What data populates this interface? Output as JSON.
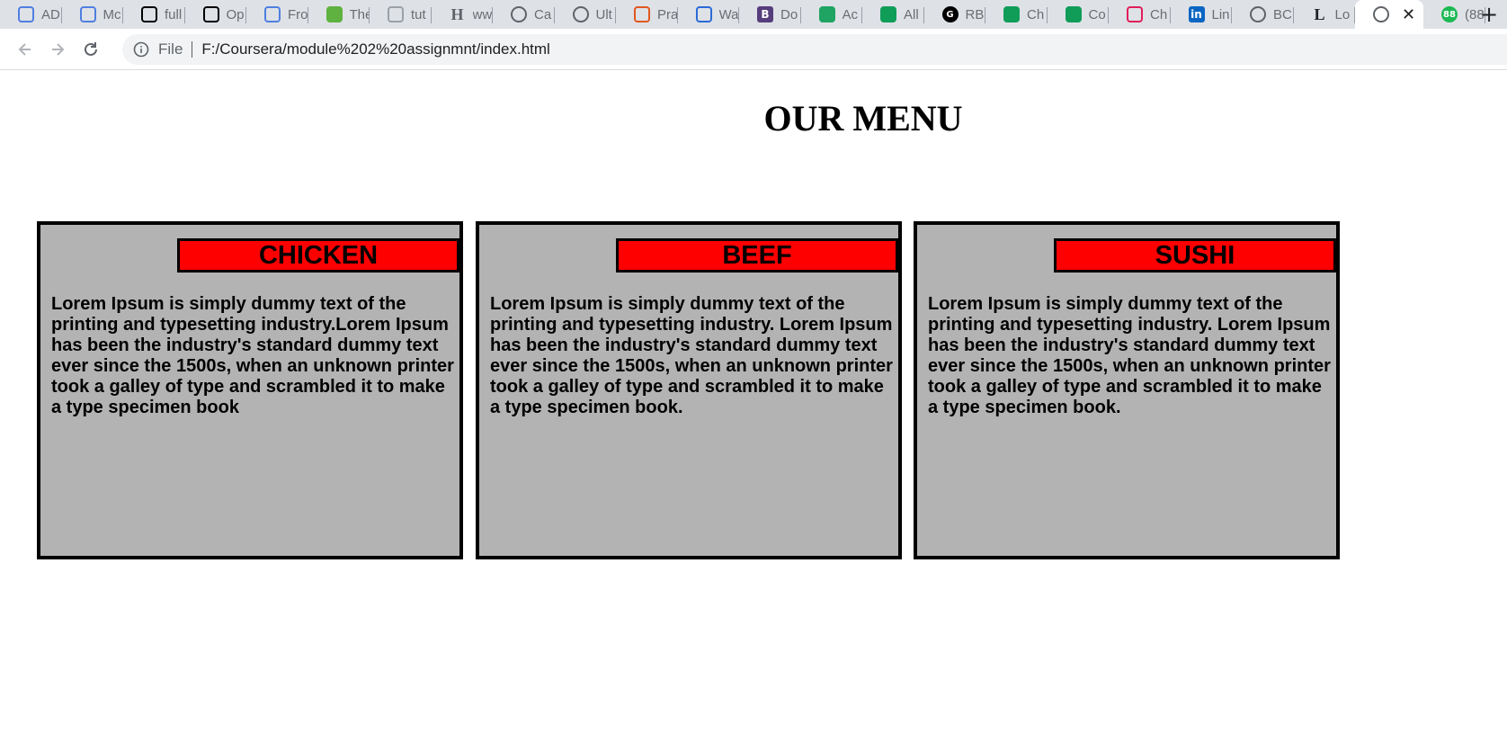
{
  "browser": {
    "tabs": [
      {
        "title": "AD",
        "icon": "infinity-icon",
        "color": "#4f7fe0"
      },
      {
        "title": "Mc",
        "icon": "infinity-icon",
        "color": "#4f7fe0"
      },
      {
        "title": "full",
        "icon": "github-icon",
        "color": "#000000"
      },
      {
        "title": "Op",
        "icon": "github-icon",
        "color": "#000000"
      },
      {
        "title": "Fro",
        "icon": "infinity-icon",
        "color": "#4f7fe0"
      },
      {
        "title": "The",
        "icon": "leaf-icon",
        "color": "#5fb240"
      },
      {
        "title": "tut",
        "icon": "code-icon",
        "color": "#9aa0a6"
      },
      {
        "title": "ww",
        "icon": "h-icon",
        "color": "#5f6368"
      },
      {
        "title": "Ca",
        "icon": "globe-icon",
        "color": "#5f6368"
      },
      {
        "title": "Ult",
        "icon": "globe-icon",
        "color": "#5f6368"
      },
      {
        "title": "Pra",
        "icon": "bracket-icon",
        "color": "#e2571e"
      },
      {
        "title": "Wa",
        "icon": "swirl-icon",
        "color": "#2a6bd8"
      },
      {
        "title": "Do",
        "icon": "bootstrap-icon",
        "color": "#563d7c"
      },
      {
        "title": "Ac",
        "icon": "drive-icon",
        "color": "#1fa463"
      },
      {
        "title": "All",
        "icon": "sheets-icon",
        "color": "#0f9d58"
      },
      {
        "title": "RB",
        "icon": "g-icon",
        "color": "#000000"
      },
      {
        "title": "Ch",
        "icon": "sheets-icon",
        "color": "#0f9d58"
      },
      {
        "title": "Co",
        "icon": "sheets-icon",
        "color": "#0f9d58"
      },
      {
        "title": "Ch",
        "icon": "slack-icon",
        "color": "#e01e5a"
      },
      {
        "title": "Lin",
        "icon": "linkedin-icon",
        "color": "#0a66c2"
      },
      {
        "title": "BC",
        "icon": "globe-icon",
        "color": "#5f6368"
      },
      {
        "title": "Lo",
        "icon": "l-icon",
        "color": "#202124"
      },
      {
        "title": "",
        "icon": "globe-icon",
        "color": "#5f6368",
        "active": true
      },
      {
        "title": "(88",
        "icon": "badge-icon",
        "color": "#1db954"
      }
    ],
    "tab_letters": [
      "",
      "",
      "",
      "",
      "",
      "",
      "",
      "H",
      "",
      "",
      "",
      "",
      "B",
      "",
      "",
      "G",
      "",
      "",
      "",
      "in",
      "",
      "L",
      "",
      "88"
    ],
    "close_glyph": "✕",
    "new_tab_glyph": "+",
    "address": {
      "scheme": "File",
      "url": "F:/Coursera/module%202%20assignmnt/index.html"
    }
  },
  "page": {
    "title": "OUR MENU",
    "cards": [
      {
        "label": "CHICKEN",
        "text": "Lorem Ipsum is simply dummy text of the printing and typesetting industry.Lorem Ipsum has been the industry's standard dummy text ever since the 1500s, when an unknown printer took a galley of type and scrambled it to make a type specimen book"
      },
      {
        "label": "BEEF",
        "text": "Lorem Ipsum is simply dummy text of the printing and typesetting industry. Lorem Ipsum has been the industry's standard dummy text ever since the 1500s, when an unknown printer took a galley of type and scrambled it to make a type specimen book."
      },
      {
        "label": "SUSHI",
        "text": "Lorem Ipsum is simply dummy text of the printing and typesetting industry. Lorem Ipsum has been the industry's standard dummy text ever since the 1500s, when an unknown printer took a galley of type and scrambled it to make a type specimen book."
      }
    ],
    "colors": {
      "card_bg": "#b3b3b3",
      "label_bg": "#ff0000",
      "border": "#000000"
    }
  }
}
